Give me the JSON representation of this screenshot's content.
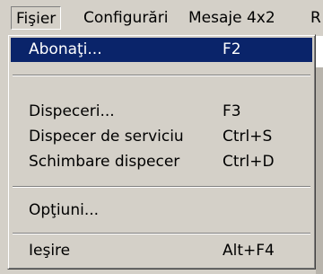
{
  "menubar": {
    "items": [
      {
        "label": "Fişier"
      },
      {
        "label": "Configurări"
      },
      {
        "label": "Mesaje 4x2"
      },
      {
        "label": "R"
      }
    ]
  },
  "menu": {
    "items": [
      {
        "label": "Abonaţi...",
        "shortcut": "F2",
        "selected": true
      },
      {
        "label": "Dispeceri...",
        "shortcut": "F3"
      },
      {
        "label": "Dispecer de serviciu",
        "shortcut": "Ctrl+S"
      },
      {
        "label": "Schimbare dispecer",
        "shortcut": "Ctrl+D"
      },
      {
        "label": "Opţiuni...",
        "shortcut": ""
      },
      {
        "label": "Ieşire",
        "shortcut": "Alt+F4"
      }
    ]
  }
}
